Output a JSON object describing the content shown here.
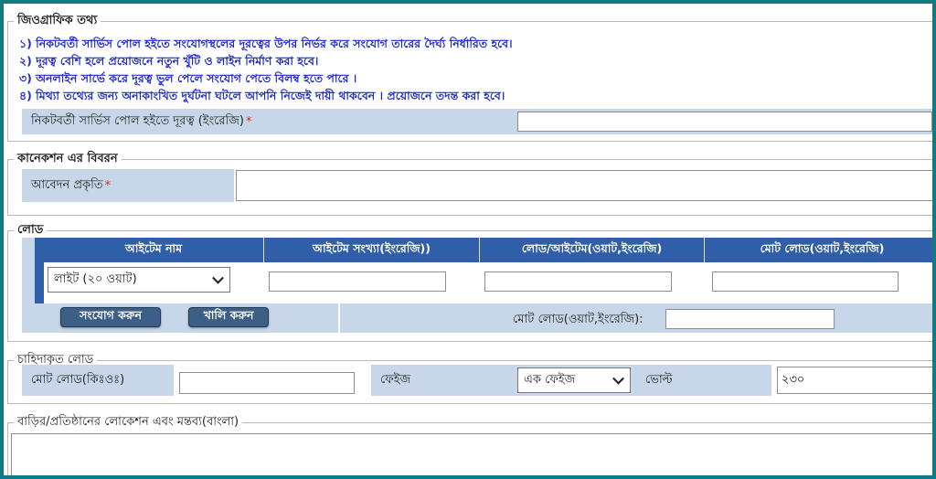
{
  "geo": {
    "legend": "জিওগ্রাফিক তথ্য",
    "notes": [
      "১) নিকটবর্তী সার্ভিস পোল হইতে সংযোগস্থলের দূরত্বের উপর নির্ভর করে সংযোগ তারের দৈর্ঘ্য নির্ধারিত হবে।",
      "২) দূরত্ব বেশি হলে প্রয়োজনে নতুন খুঁটি ও লাইন নির্মাণ করা হবে।",
      "৩) অনলাইন সার্ভে করে দূরত্ব ভুল পেলে সংযোগ পেতে বিলম্ব হতে পারে ।",
      "৪) মিথ্যা তথ্যের জন্য অনাকাংখিত দুর্ঘটনা ঘটলে আপনি নিজেই দায়ী থাকবেন । প্রয়োজনে তদন্ত করা হবে।"
    ],
    "distance_label": "নিকটবর্তী সার্ভিস পোল হইতে দূরত্ব (ইংরেজি)",
    "required_mark": "*",
    "distance_value": ""
  },
  "connection": {
    "legend": "কানেকশন এর বিবরন",
    "application_type_label": "আবেদন প্রকৃতি",
    "required_mark": "*",
    "application_type_value": ""
  },
  "load": {
    "legend": "লোড",
    "columns": [
      "আইটেম নাম",
      "আইটেম সংখ্যা(ইংরেজি))",
      "লোড/আইটেম(ওয়াট,ইংরেজি)",
      "মোট লোড(ওয়াট,ইংরেজি)"
    ],
    "item_selected": "লাইট (২০ ওয়াট)",
    "item_count": "",
    "load_per_item": "",
    "total_load_row": "",
    "add_button": "সংযোগ করুন",
    "clear_button": "খালি করুন",
    "total_label": "মোট লোড(ওয়াট,ইংরেজি):",
    "total_value": ""
  },
  "demand": {
    "legend": "চাহিদাকৃত লোড",
    "total_kw_label": "মোট লোড(কিঃওঃ)",
    "total_kw_value": "",
    "phase_label": "ফেইজ",
    "phase_selected": "এক ফেইজ",
    "volt_label": "ভোল্ট",
    "volt_value": "২৩০"
  },
  "location": {
    "legend": "বাড়ির/প্রতিষ্ঠানের লোকেশন এবং মন্তব্য(বাংলা)",
    "value": ""
  },
  "colors": {
    "frame": "#0f7b82",
    "note_text": "#1f2bc9",
    "label_bg": "#c7d7e9",
    "table_header": "#2f5fa8",
    "button": "#3b5f86"
  }
}
